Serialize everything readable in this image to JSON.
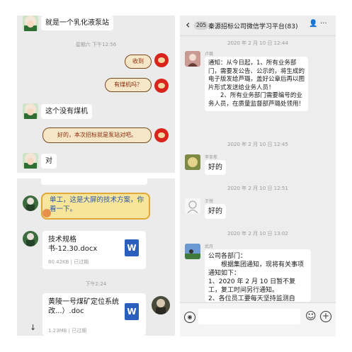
{
  "top_left": {
    "msg1": "就是一个乳化液泵站",
    "time1": "星期六 下午12:56",
    "sticker1": "收到",
    "sticker2": "有煤机吗？",
    "msg2": "这个没有煤机",
    "sticker3": "好的，本次招标就是泵站对吧。",
    "msg3": "对"
  },
  "bottom_left": {
    "note": "单工，这是大屏的技术方案，你看一下。",
    "file1_name": "技术规格书-12.30.docx",
    "file1_meta": "80.42KB | 已过期",
    "time": "下午2:24",
    "file2_name": "黄陵一号煤矿定位系统改...）.doc",
    "file2_meta": "1.23MB | 已过期",
    "word_letter": "W",
    "download_glyph": "↓"
  },
  "right": {
    "header": {
      "back_glyph": "‹",
      "badge": "205",
      "title": "秦源招标公司微信学习平台(83)",
      "person_glyph": "👤",
      "more_glyph": "···"
    },
    "messages": [
      {
        "time": "2020 年 2 月 10 日 12:44",
        "sender": "卢璐",
        "text": "通知：从今日起，1、所有业务部门，需要发公告、公示的，将生成的电子版发给芦璐，盖好公章后再以图片形式发送给业务人员！\n　　2、所有业务部门需要编号的业务人员，在质量监督部芦璐处领用！"
      },
      {
        "time": "2020 年 2 月 10 日 12:45",
        "sender": "李亚希",
        "text": "好的"
      },
      {
        "time": "2020 年 2 月 10 日 12:51",
        "sender": "王悦",
        "text": "好的"
      },
      {
        "time": "2020 年 2 月 10 日 13:02",
        "sender": "武月",
        "text": "公司各部门：\n　　根据集团通知，现将有关事项通知如下：\n1、2020 年 2 月 10 日暂不复工，复工时间另行通知。\n2、各位员工要每天坚持监测自"
      }
    ],
    "footer": {
      "voice_glyph": "◉",
      "emoji_glyph": "☺",
      "plus_glyph": "+"
    }
  }
}
